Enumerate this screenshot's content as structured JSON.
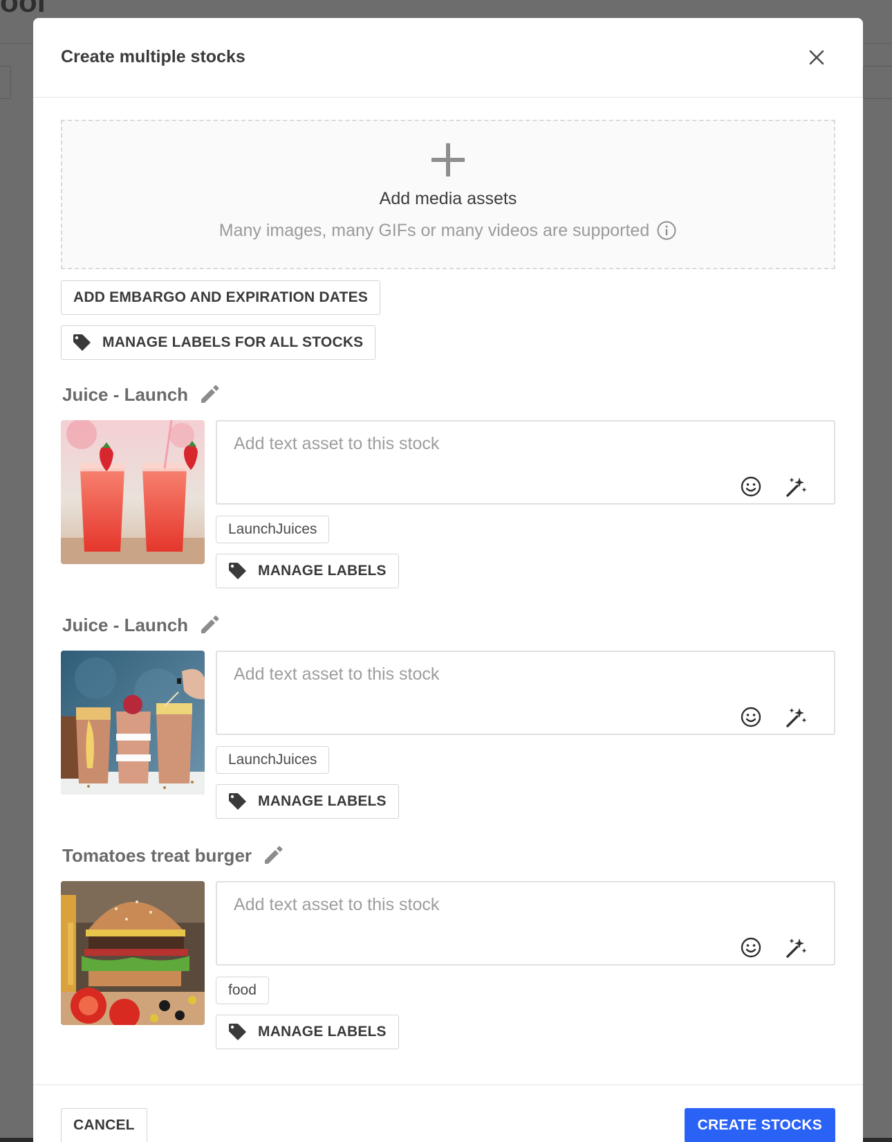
{
  "background": {
    "title_fragment": "ool"
  },
  "modal": {
    "title": "Create multiple stocks",
    "dropzone": {
      "title": "Add media assets",
      "subtitle": "Many images, many GIFs or many videos are supported"
    },
    "embargo_button": "ADD EMBARGO AND EXPIRATION DATES",
    "manage_all_labels_button": "MANAGE LABELS FOR ALL STOCKS",
    "stocks": [
      {
        "title": "Juice - Launch",
        "text_placeholder": "Add text asset to this stock",
        "label": "LaunchJuices",
        "manage_labels": "MANAGE LABELS",
        "image": "strawberry-juice-glasses"
      },
      {
        "title": "Juice - Launch",
        "text_placeholder": "Add text asset to this stock",
        "label": "LaunchJuices",
        "manage_labels": "MANAGE LABELS",
        "image": "smoothie-jars"
      },
      {
        "title": "Tomatoes treat burger",
        "text_placeholder": "Add text asset to this stock",
        "label": "food",
        "manage_labels": "MANAGE LABELS",
        "image": "burger"
      }
    ],
    "footer": {
      "cancel": "CANCEL",
      "create": "CREATE STOCKS"
    }
  },
  "colors": {
    "primary": "#2b62f6",
    "overlay": "#6d6d6d"
  }
}
